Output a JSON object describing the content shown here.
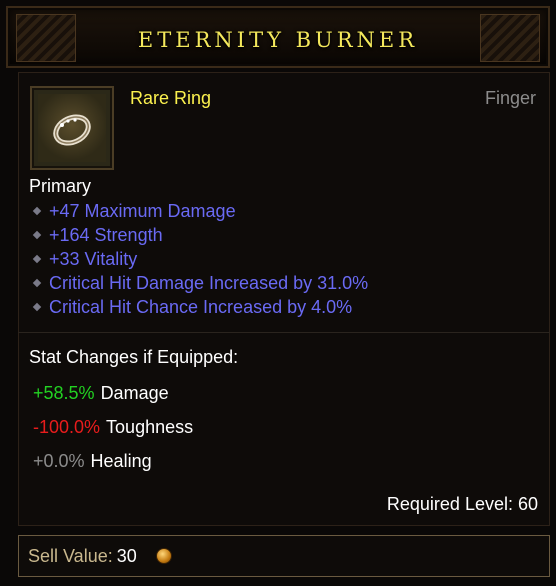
{
  "item": {
    "name": "ETERNITY BURNER",
    "rarity_type": "Rare Ring",
    "slot": "Finger",
    "icon": "ring-icon"
  },
  "primary": {
    "label": "Primary",
    "affixes": [
      "+47 Maximum Damage",
      "+164 Strength",
      "+33 Vitality",
      "Critical Hit Damage Increased by 31.0%",
      "Critical Hit Chance Increased by 4.0%"
    ]
  },
  "stat_changes": {
    "header": "Stat Changes if Equipped:",
    "rows": [
      {
        "value": "+58.5%",
        "label": "Damage",
        "color": "#22d222"
      },
      {
        "value": "-100.0%",
        "label": "Toughness",
        "color": "#e81c1c"
      },
      {
        "value": "+0.0%",
        "label": "Healing",
        "color": "#8c8c8c"
      }
    ]
  },
  "requirements": {
    "level_text": "Required Level: 60"
  },
  "sell": {
    "label": "Sell Value:",
    "value": "30",
    "icon": "gold-coin-icon"
  },
  "colors": {
    "title": "#f4e85c",
    "rare": "#fbf14e",
    "affix": "#6a6af4"
  }
}
